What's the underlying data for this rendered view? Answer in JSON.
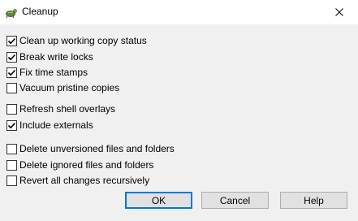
{
  "window": {
    "title": "Cleanup",
    "icon": "tortoisesvn-icon"
  },
  "options": [
    {
      "label": "Clean up working copy status",
      "checked": true
    },
    {
      "label": "Break write locks",
      "checked": true
    },
    {
      "label": "Fix time stamps",
      "checked": true
    },
    {
      "label": "Vacuum pristine copies",
      "checked": false
    },
    {
      "label": "Refresh shell overlays",
      "checked": false
    },
    {
      "label": "Include externals",
      "checked": true
    },
    {
      "label": "Delete unversioned files and folders",
      "checked": false
    },
    {
      "label": "Delete ignored files and folders",
      "checked": false
    },
    {
      "label": "Revert all changes recursively",
      "checked": false
    }
  ],
  "buttons": {
    "ok": "OK",
    "cancel": "Cancel",
    "help": "Help"
  },
  "colors": {
    "default_button_border": "#0078d7",
    "dialog_bg": "#f0f0f0"
  }
}
